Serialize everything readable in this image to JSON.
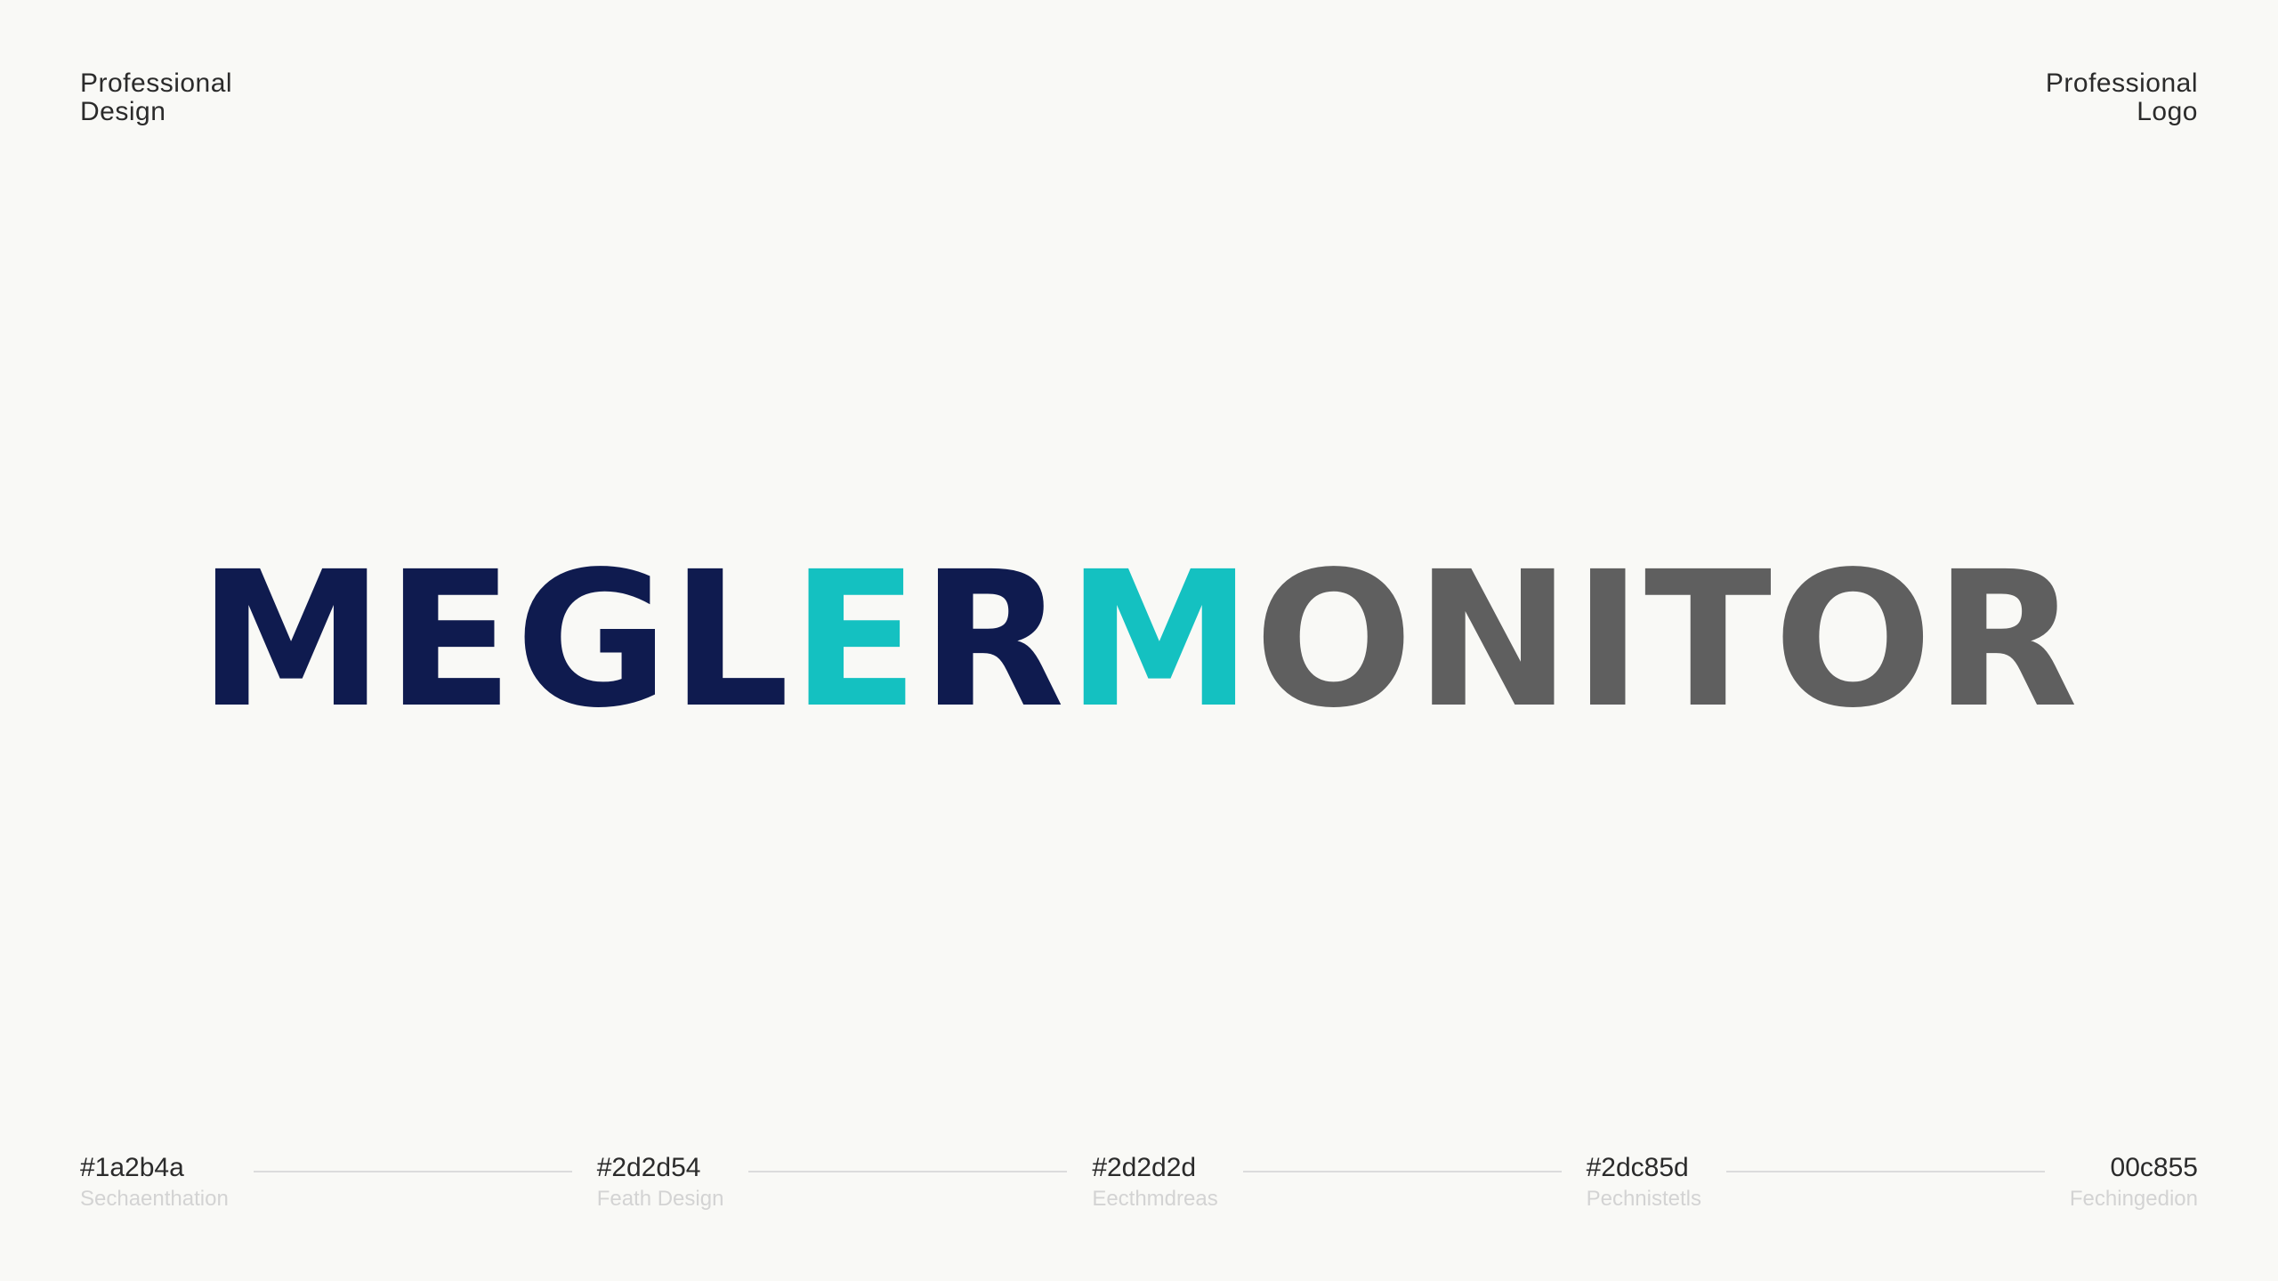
{
  "corners": {
    "left": [
      "Professional",
      "Design"
    ],
    "right": [
      "Professional",
      "Logo"
    ]
  },
  "logo": {
    "part1": "MEGL",
    "part2": "E",
    "part3": "R",
    "part4": "M",
    "part5": "ONITOR",
    "colors": {
      "navy": "#0f1b4f",
      "teal": "#14c1c1",
      "gray": "#5f5f5f"
    }
  },
  "palette": [
    {
      "hex": "#1a2b4a",
      "sub": "Sechaenthation"
    },
    {
      "hex": "#2d2d54",
      "sub": "Feath Design"
    },
    {
      "hex": "#2d2d2d",
      "sub": "Eecthmdreas"
    },
    {
      "hex": "#2dc85d",
      "sub": "Pechnistetls"
    },
    {
      "hex": "00c855",
      "sub": "Fechingedion"
    }
  ]
}
